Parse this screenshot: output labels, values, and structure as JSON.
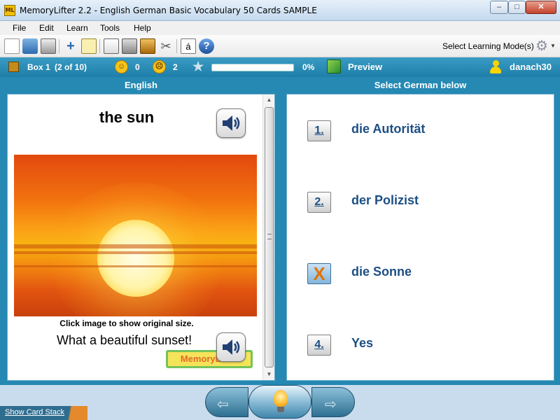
{
  "window": {
    "app_icon_text": "ML",
    "title": "MemoryLifter 2.2 - English German Basic Vocabulary 50 Cards SAMPLE",
    "minimize": "–",
    "maximize": "□",
    "close": "✕"
  },
  "menu": [
    "File",
    "Edit",
    "Learn",
    "Tools",
    "Help"
  ],
  "toolbar": {
    "icons": [
      "new-file-icon",
      "open-folder-icon",
      "print-icon",
      "add-card-icon",
      "edit-card-icon",
      "presentation-icon",
      "statistics-icon",
      "dictionary-icon",
      "tools-icon",
      "special-char-icon",
      "help-icon"
    ],
    "special_char": "á",
    "help_char": "?",
    "mode_label": "Select Learning Mode(s)"
  },
  "status": {
    "box_label": "Box 1",
    "box_count": "(2 of 10)",
    "correct_count": "0",
    "wrong_count": "2",
    "progress_percent": "0%",
    "progress_value": 0,
    "preview_label": "Preview",
    "username": "danach30"
  },
  "question": {
    "language": "English",
    "word": "the sun",
    "image_hint": "Click image to show original size.",
    "example": "What a beautiful sunset!",
    "logo_text": "MemoryLifter"
  },
  "answers": {
    "header": "Select German below",
    "options": [
      {
        "key": "1.",
        "text": "die Autorität",
        "state": "normal"
      },
      {
        "key": "2.",
        "text": "der Polizist",
        "state": "normal"
      },
      {
        "key": "X",
        "text": "die Sonne",
        "state": "wrong"
      },
      {
        "key": "4.",
        "text": "Yes",
        "state": "normal"
      }
    ]
  },
  "footer": {
    "show_card_stack": "Show Card Stack",
    "back_arrow": "⇦",
    "forward_arrow": "⇨"
  },
  "colors": {
    "status_bar": "#2589b3",
    "answer_text": "#1d4f84",
    "wrong_mark": "#e0740a",
    "progress_fill": "#3cb84a"
  }
}
